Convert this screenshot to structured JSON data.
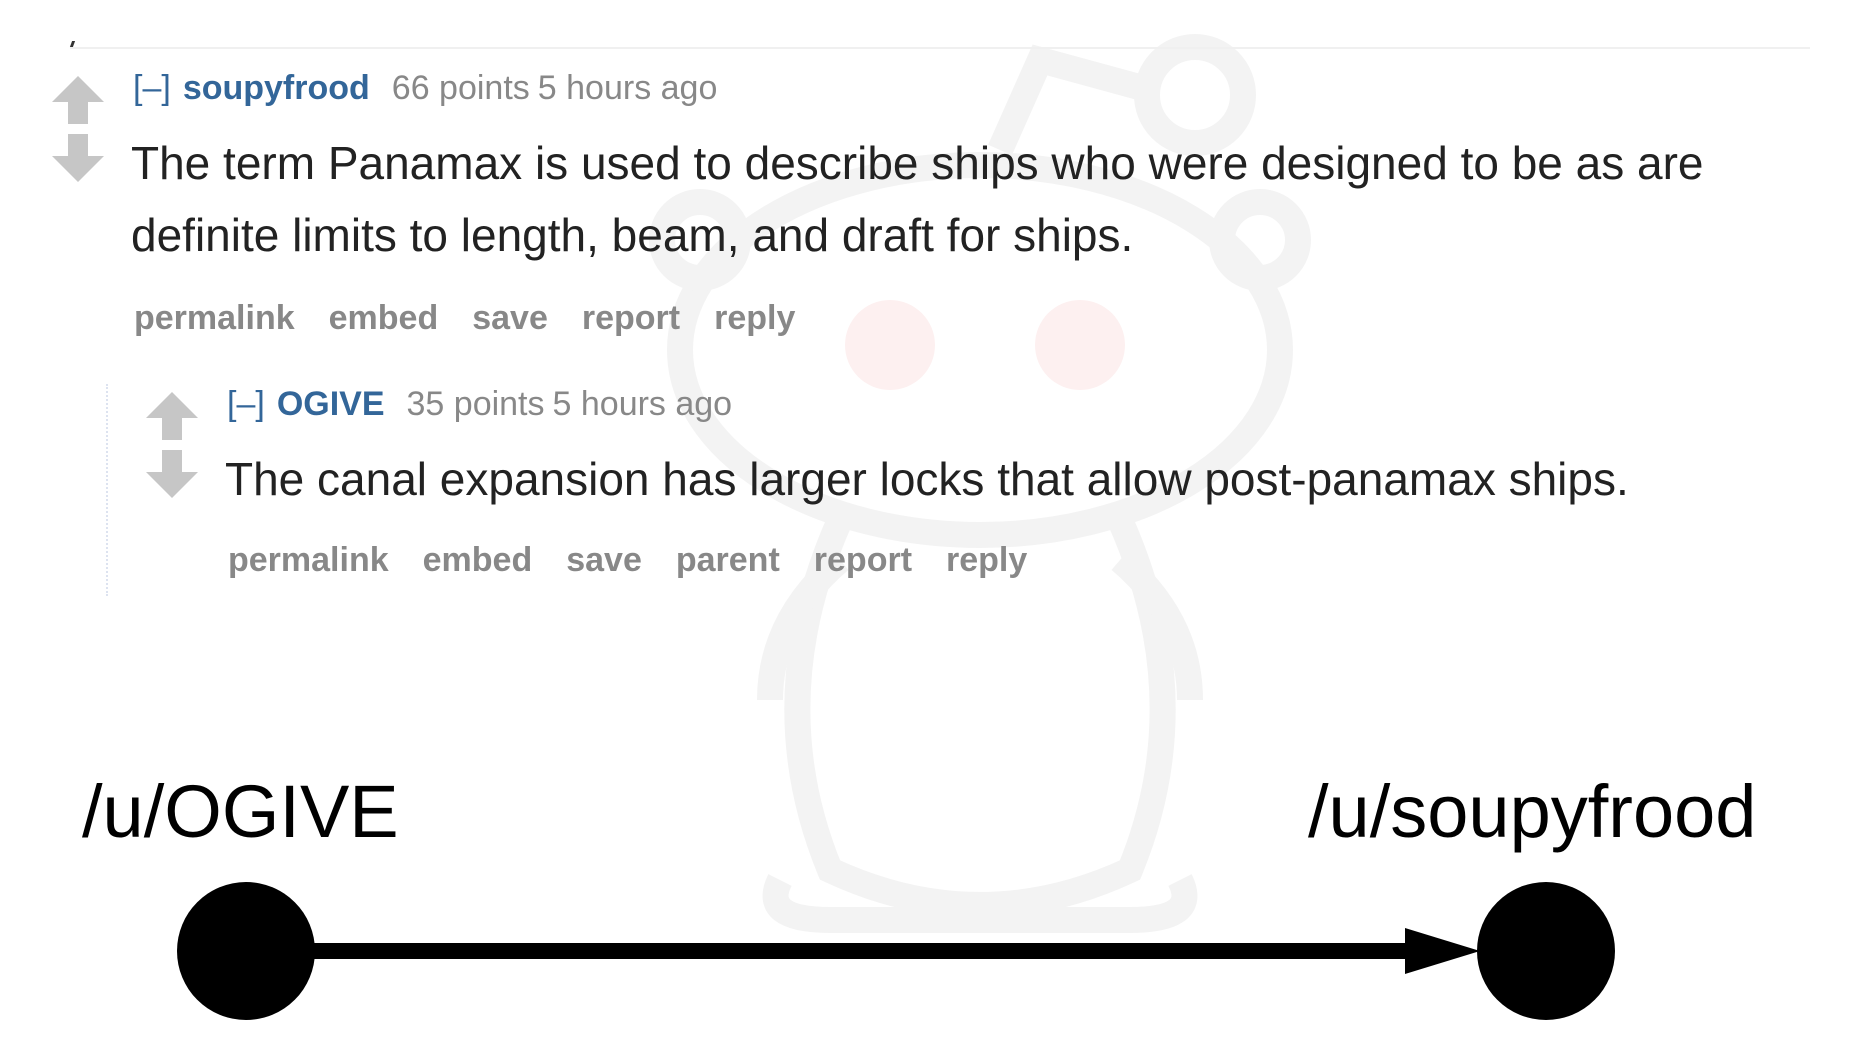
{
  "thread": {
    "parent_comment": {
      "expand_label": "[–]",
      "author": "soupyfrood",
      "score": "66 points",
      "time": "5 hours ago",
      "body": "The term Panamax is used to describe ships who were designed to be as are definite limits to length, beam, and draft for ships.",
      "actions": [
        "permalink",
        "embed",
        "save",
        "report",
        "reply"
      ]
    },
    "child_comment": {
      "expand_label": "[–]",
      "author": "OGIVE",
      "score": "35 points",
      "time": "5 hours ago",
      "body": "The canal expansion has larger locks that allow post-panamax ships.",
      "actions": [
        "permalink",
        "embed",
        "save",
        "parent",
        "report",
        "reply"
      ]
    }
  },
  "graph": {
    "source_label": "/u/OGIVE",
    "target_label": "/u/soupyfrood",
    "edge_direction": "source-to-target"
  },
  "colors": {
    "author_link": "#336699",
    "meta_text": "#888888",
    "body_text": "#222222",
    "vote_arrow": "#c6c6c6",
    "watermark": "#f4f4f4",
    "watermark_eyes": "#fdeeee",
    "graph": "#000000"
  },
  "icons": {
    "upvote": "upvote-arrow-icon",
    "downvote": "downvote-arrow-icon",
    "watermark": "alien-mascot-watermark"
  }
}
